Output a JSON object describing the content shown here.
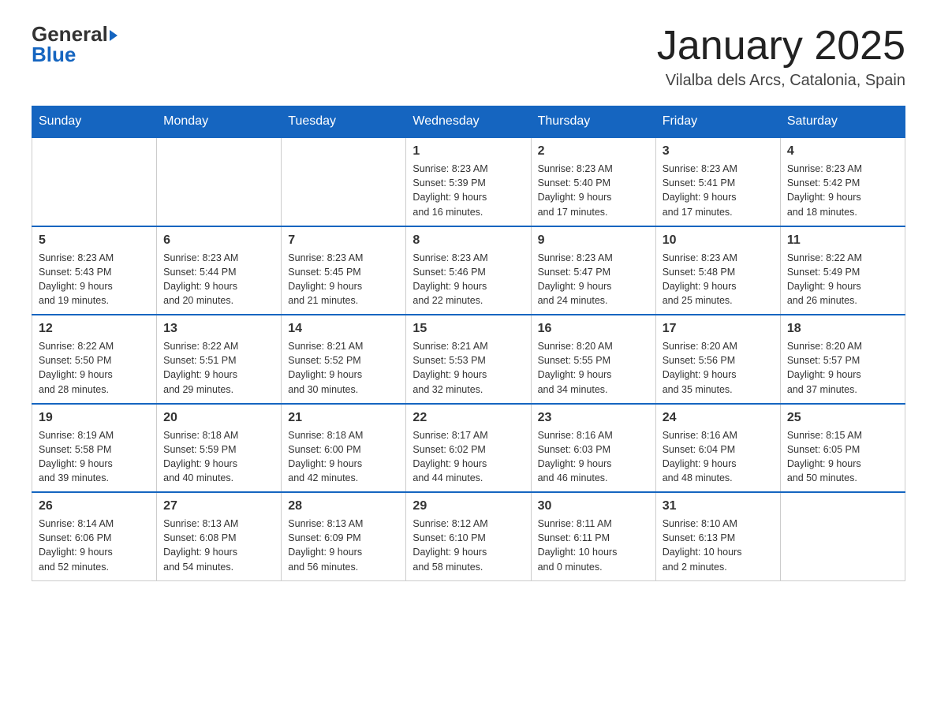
{
  "header": {
    "logo_general": "General",
    "logo_blue": "Blue",
    "main_title": "January 2025",
    "subtitle": "Vilalba dels Arcs, Catalonia, Spain"
  },
  "days_of_week": [
    "Sunday",
    "Monday",
    "Tuesday",
    "Wednesday",
    "Thursday",
    "Friday",
    "Saturday"
  ],
  "weeks": [
    [
      {
        "day": "",
        "info": ""
      },
      {
        "day": "",
        "info": ""
      },
      {
        "day": "",
        "info": ""
      },
      {
        "day": "1",
        "info": "Sunrise: 8:23 AM\nSunset: 5:39 PM\nDaylight: 9 hours\nand 16 minutes."
      },
      {
        "day": "2",
        "info": "Sunrise: 8:23 AM\nSunset: 5:40 PM\nDaylight: 9 hours\nand 17 minutes."
      },
      {
        "day": "3",
        "info": "Sunrise: 8:23 AM\nSunset: 5:41 PM\nDaylight: 9 hours\nand 17 minutes."
      },
      {
        "day": "4",
        "info": "Sunrise: 8:23 AM\nSunset: 5:42 PM\nDaylight: 9 hours\nand 18 minutes."
      }
    ],
    [
      {
        "day": "5",
        "info": "Sunrise: 8:23 AM\nSunset: 5:43 PM\nDaylight: 9 hours\nand 19 minutes."
      },
      {
        "day": "6",
        "info": "Sunrise: 8:23 AM\nSunset: 5:44 PM\nDaylight: 9 hours\nand 20 minutes."
      },
      {
        "day": "7",
        "info": "Sunrise: 8:23 AM\nSunset: 5:45 PM\nDaylight: 9 hours\nand 21 minutes."
      },
      {
        "day": "8",
        "info": "Sunrise: 8:23 AM\nSunset: 5:46 PM\nDaylight: 9 hours\nand 22 minutes."
      },
      {
        "day": "9",
        "info": "Sunrise: 8:23 AM\nSunset: 5:47 PM\nDaylight: 9 hours\nand 24 minutes."
      },
      {
        "day": "10",
        "info": "Sunrise: 8:23 AM\nSunset: 5:48 PM\nDaylight: 9 hours\nand 25 minutes."
      },
      {
        "day": "11",
        "info": "Sunrise: 8:22 AM\nSunset: 5:49 PM\nDaylight: 9 hours\nand 26 minutes."
      }
    ],
    [
      {
        "day": "12",
        "info": "Sunrise: 8:22 AM\nSunset: 5:50 PM\nDaylight: 9 hours\nand 28 minutes."
      },
      {
        "day": "13",
        "info": "Sunrise: 8:22 AM\nSunset: 5:51 PM\nDaylight: 9 hours\nand 29 minutes."
      },
      {
        "day": "14",
        "info": "Sunrise: 8:21 AM\nSunset: 5:52 PM\nDaylight: 9 hours\nand 30 minutes."
      },
      {
        "day": "15",
        "info": "Sunrise: 8:21 AM\nSunset: 5:53 PM\nDaylight: 9 hours\nand 32 minutes."
      },
      {
        "day": "16",
        "info": "Sunrise: 8:20 AM\nSunset: 5:55 PM\nDaylight: 9 hours\nand 34 minutes."
      },
      {
        "day": "17",
        "info": "Sunrise: 8:20 AM\nSunset: 5:56 PM\nDaylight: 9 hours\nand 35 minutes."
      },
      {
        "day": "18",
        "info": "Sunrise: 8:20 AM\nSunset: 5:57 PM\nDaylight: 9 hours\nand 37 minutes."
      }
    ],
    [
      {
        "day": "19",
        "info": "Sunrise: 8:19 AM\nSunset: 5:58 PM\nDaylight: 9 hours\nand 39 minutes."
      },
      {
        "day": "20",
        "info": "Sunrise: 8:18 AM\nSunset: 5:59 PM\nDaylight: 9 hours\nand 40 minutes."
      },
      {
        "day": "21",
        "info": "Sunrise: 8:18 AM\nSunset: 6:00 PM\nDaylight: 9 hours\nand 42 minutes."
      },
      {
        "day": "22",
        "info": "Sunrise: 8:17 AM\nSunset: 6:02 PM\nDaylight: 9 hours\nand 44 minutes."
      },
      {
        "day": "23",
        "info": "Sunrise: 8:16 AM\nSunset: 6:03 PM\nDaylight: 9 hours\nand 46 minutes."
      },
      {
        "day": "24",
        "info": "Sunrise: 8:16 AM\nSunset: 6:04 PM\nDaylight: 9 hours\nand 48 minutes."
      },
      {
        "day": "25",
        "info": "Sunrise: 8:15 AM\nSunset: 6:05 PM\nDaylight: 9 hours\nand 50 minutes."
      }
    ],
    [
      {
        "day": "26",
        "info": "Sunrise: 8:14 AM\nSunset: 6:06 PM\nDaylight: 9 hours\nand 52 minutes."
      },
      {
        "day": "27",
        "info": "Sunrise: 8:13 AM\nSunset: 6:08 PM\nDaylight: 9 hours\nand 54 minutes."
      },
      {
        "day": "28",
        "info": "Sunrise: 8:13 AM\nSunset: 6:09 PM\nDaylight: 9 hours\nand 56 minutes."
      },
      {
        "day": "29",
        "info": "Sunrise: 8:12 AM\nSunset: 6:10 PM\nDaylight: 9 hours\nand 58 minutes."
      },
      {
        "day": "30",
        "info": "Sunrise: 8:11 AM\nSunset: 6:11 PM\nDaylight: 10 hours\nand 0 minutes."
      },
      {
        "day": "31",
        "info": "Sunrise: 8:10 AM\nSunset: 6:13 PM\nDaylight: 10 hours\nand 2 minutes."
      },
      {
        "day": "",
        "info": ""
      }
    ]
  ]
}
